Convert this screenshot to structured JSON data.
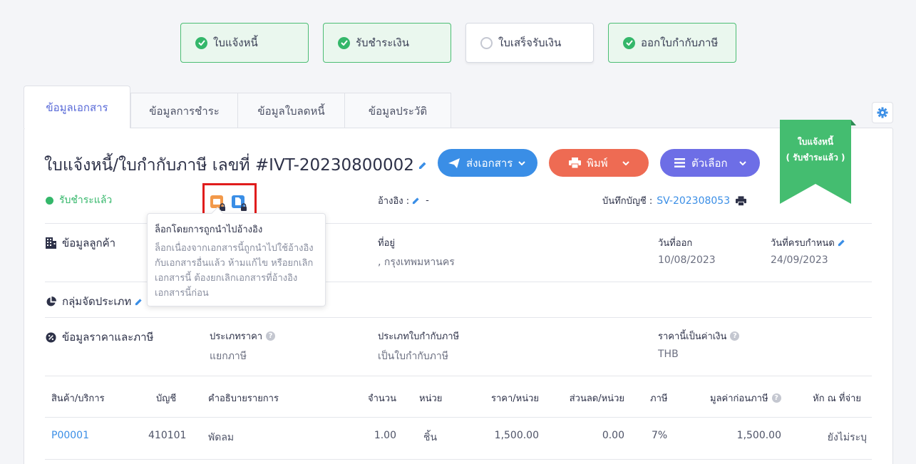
{
  "steps": [
    {
      "label": "ใบแจ้งหนี้",
      "done": true
    },
    {
      "label": "รับชำระเงิน",
      "done": true
    },
    {
      "label": "ใบเสร็จรับเงิน",
      "done": false
    },
    {
      "label": "ออกใบกำกับภาษี",
      "done": true
    }
  ],
  "tabs": [
    "ข้อมูลเอกสาร",
    "ข้อมูลการชำระ",
    "ข้อมูลใบลดหนี้",
    "ข้อมูลประวัติ"
  ],
  "doc": {
    "title": "ใบแจ้งหนี้/ใบกำกับภาษี เลขที่ #IVT-20230800002",
    "status": "รับชำระแล้ว",
    "ref_label": "อ้างอิง :",
    "ref_value": "-",
    "book_label": "บันทึกบัญชี :",
    "book_value": "SV-202308053"
  },
  "buttons": {
    "send": "ส่งเอกสาร",
    "print": "พิมพ์",
    "options": "ตัวเลือก"
  },
  "ribbon": {
    "line1": "ใบแจ้งหนี้",
    "line2": "( รับชำระแล้ว )"
  },
  "tooltip": {
    "title": "ล็อกโดยการถูกนำไปอ้างอิง",
    "body": "ล็อกเนื่องจากเอกสารนี้ถูกนำไปใช้อ้างอิงกับเอกสารอื่นแล้ว ห้ามแก้ไข หรือยกเลิกเอกสารนี้ ต้องยกเลิกเอกสารที่อ้างอิงเอกสารนี้ก่อน"
  },
  "customer": {
    "section": "ข้อมูลลูกค้า",
    "address_label": "ที่อยู่",
    "address_value": ", กรุงเทพมหานคร",
    "issue_label": "วันที่ออก",
    "issue_value": "10/08/2023",
    "due_label": "วันที่ครบกำหนด",
    "due_value": "24/09/2023"
  },
  "group": {
    "section": "กลุ่มจัดประเภท"
  },
  "pricing": {
    "section": "ข้อมูลราคาและภาษี",
    "price_type_label": "ประเภทราคา",
    "price_type_value": "แยกภาษี",
    "tax_doc_label": "ประเภทใบกำกับภาษี",
    "tax_doc_value": "เป็นใบกำกับภาษี",
    "currency_label": "ราคานี้เป็นค่าเงิน",
    "currency_value": "THB"
  },
  "table": {
    "headers": {
      "product": "สินค้า/บริการ",
      "account": "บัญชี",
      "desc": "คำอธิบายรายการ",
      "qty": "จำนวน",
      "unit": "หน่วย",
      "price": "ราคา/หน่วย",
      "discount": "ส่วนลด/หน่วย",
      "tax": "ภาษี",
      "pretax": "มูลค่าก่อนภาษี",
      "wht": "หัก ณ ที่จ่าย"
    },
    "rows": [
      {
        "product": "P00001",
        "account": "410101",
        "desc": "พัดลม",
        "qty": "1.00",
        "unit": "ชิ้น",
        "price": "1,500.00",
        "discount": "0.00",
        "tax": "7%",
        "pretax": "1,500.00",
        "wht": "ยังไม่ระบุ"
      }
    ]
  },
  "colors": {
    "accent": "#5a6bd8",
    "success": "#34b76a",
    "send": "#3a8ee6",
    "print": "#ee6b53",
    "options": "#6d6ee6"
  },
  "icons": [
    "check-circle-icon",
    "empty-circle-icon",
    "gear-icon",
    "pencil-icon",
    "paper-plane-icon",
    "printer-icon",
    "menu-icon",
    "chevron-down-icon",
    "lock-icon",
    "building-icon",
    "pie-chart-icon",
    "percent-badge-icon",
    "help-icon"
  ]
}
